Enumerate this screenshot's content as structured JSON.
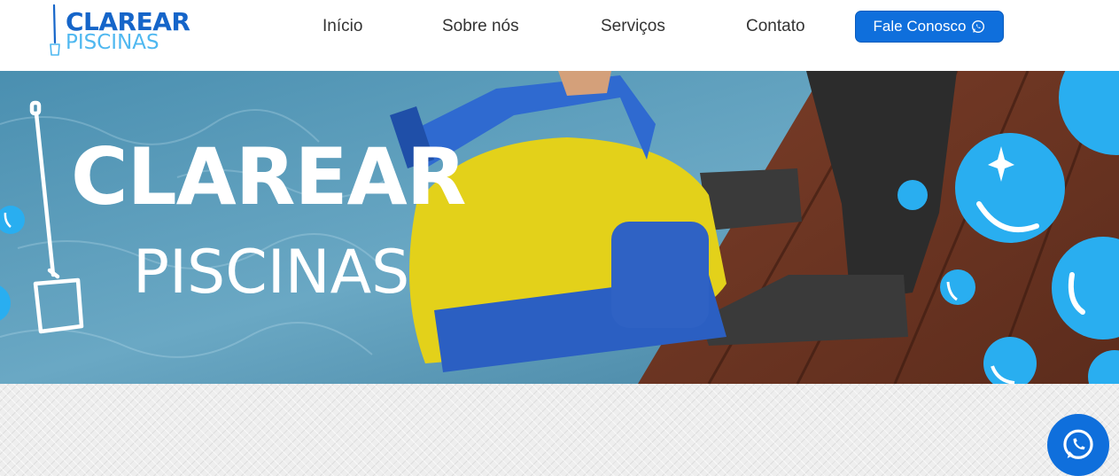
{
  "brand": {
    "name_top": "CLAREAR",
    "name_bottom": "PISCINAS",
    "primary_color": "#1565c9",
    "secondary_color": "#4fb8f0"
  },
  "nav": {
    "items": [
      {
        "label": "Início"
      },
      {
        "label": "Sobre nós"
      },
      {
        "label": "Serviços"
      },
      {
        "label": "Contato"
      }
    ],
    "cta_label": "Fale Conosco",
    "cta_icon": "whatsapp-icon",
    "cta_color": "#0f6fdc"
  },
  "hero": {
    "title": "CLAREAR",
    "subtitle": "PISCINAS"
  },
  "floating_button": {
    "icon": "whatsapp-icon",
    "color": "#0f6fdc"
  }
}
